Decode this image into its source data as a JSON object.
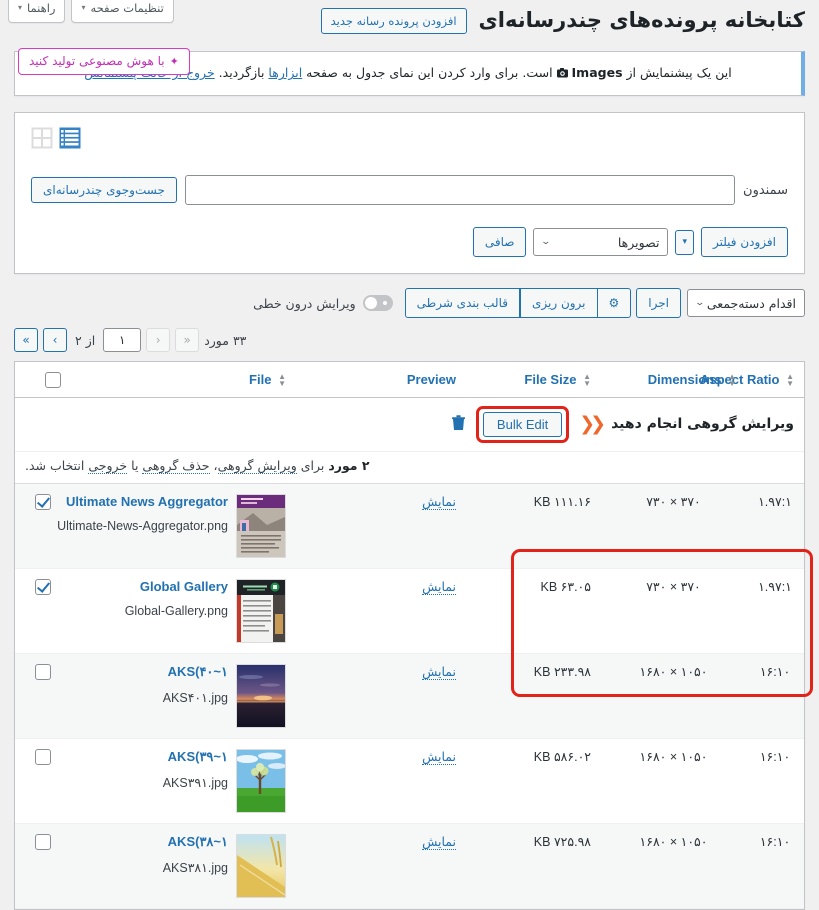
{
  "screen_meta": {
    "page_options_label": "تنظیمات صفحه",
    "help_label": "راهنما",
    "caret": "▾"
  },
  "header": {
    "title": "کتابخانه پرونده‌های چندرسانه‌ای",
    "add_new_label": "افزودن پرونده رسانه جدید",
    "ai_badge_label": "با هوش مصنوعی تولید کنید",
    "ai_badge_icon": "sparkle-icon"
  },
  "notice": {
    "text_before": "این یک پیشنمایش از",
    "tag": "Images",
    "text_mid": "است. برای وارد کردن این نمای جدول به صفحه",
    "link_tools": "ابزارها",
    "text_after": "بازگردید.",
    "link_exit": "خروج از حالت پیشنمایش"
  },
  "view_switch": {
    "grid_icon": "grid-view-icon",
    "list_icon": "list-view-icon",
    "active": "list"
  },
  "search": {
    "label": "سمندون",
    "value": "",
    "placeholder": "",
    "button_label": "جست‌وجوی چندرسانه‌ای"
  },
  "filters": {
    "add_filter_label": "افزودن فیلتر",
    "add_filter_caret": "▾",
    "type_select_value": "تصویرها",
    "type_select_chev": "⌄",
    "clear_label": "صافی"
  },
  "tablenav": {
    "bulk_select_value": "اقدام دسته‌جمعی",
    "bulk_select_chev": "⌄",
    "apply_label": "اجرا",
    "gear_icon": "gear-icon",
    "export_label": "برون ریزی",
    "conditional_format_label": "قالب بندی شرطی",
    "inline_edit_label": "ویرایش درون خطی",
    "inline_edit_on": false
  },
  "pagination": {
    "count_text": "۳۳ مورد",
    "first": "«",
    "prev": "‹",
    "of_text": "از ۲",
    "current_page": "۱",
    "next": "›",
    "last": "»"
  },
  "table": {
    "columns": {
      "check": "",
      "file": "File",
      "preview": "Preview",
      "size": "File Size",
      "dimensions": "Dimensions",
      "ratio": "Aspect Ratio"
    },
    "bulk_row": {
      "trash_icon": "trash-icon",
      "bulk_edit_label": "Bulk Edit",
      "arrows_icon": "double-chevron-left-icon",
      "callout": "ویرایش گروهی انجام دهید"
    },
    "selection_note": {
      "count": "۲ مورد",
      "text_1": "برای",
      "link_1": "ویرایش گروهی",
      "sep_1": "،",
      "link_2": "حذف گروهی",
      "text_2": "یا",
      "link_3": "خروجی",
      "text_3": "انتخاب شد."
    },
    "preview_link_label": "نمایش",
    "rows": [
      {
        "checked": true,
        "title": "Ultimate News Aggregator",
        "filename": "Ultimate-News-Aggregator.png",
        "thumb": "news-purple",
        "size": "۱۱۱.۱۶ KB",
        "dimensions": "۳۷۰ × ۷۳۰",
        "ratio": "۱.۹۷:۱"
      },
      {
        "checked": true,
        "title": "Global Gallery",
        "filename": "Global-Gallery.png",
        "thumb": "gallery-dark",
        "size": "۶۳.۰۵ KB",
        "dimensions": "۳۷۰ × ۷۳۰",
        "ratio": "۱.۹۷:۱"
      },
      {
        "checked": false,
        "title": "AKS(۴۰~۱",
        "filename": "AKS۴۰۱.jpg",
        "thumb": "sunset",
        "size": "۲۳۳.۹۸ KB",
        "dimensions": "۱۰۵۰ × ۱۶۸۰",
        "ratio": "۱۶:۱۰"
      },
      {
        "checked": false,
        "title": "AKS(۳۹~۱",
        "filename": "AKS۳۹۱.jpg",
        "thumb": "tree-green",
        "size": "۵۸۶.۰۲ KB",
        "dimensions": "۱۰۵۰ × ۱۶۸۰",
        "ratio": "۱۶:۱۰"
      },
      {
        "checked": false,
        "title": "AKS(۳۸~۱",
        "filename": "AKS۳۸۱.jpg",
        "thumb": "wheat",
        "size": "۷۲۵.۹۸ KB",
        "dimensions": "۱۰۵۰ × ۱۶۸۰",
        "ratio": "۱۶:۱۰"
      }
    ]
  },
  "colors": {
    "accent_blue": "#2271b1",
    "highlight_red": "#e2231a",
    "ai_pink": "#c231b3",
    "arrow_orange": "#f0672c"
  }
}
